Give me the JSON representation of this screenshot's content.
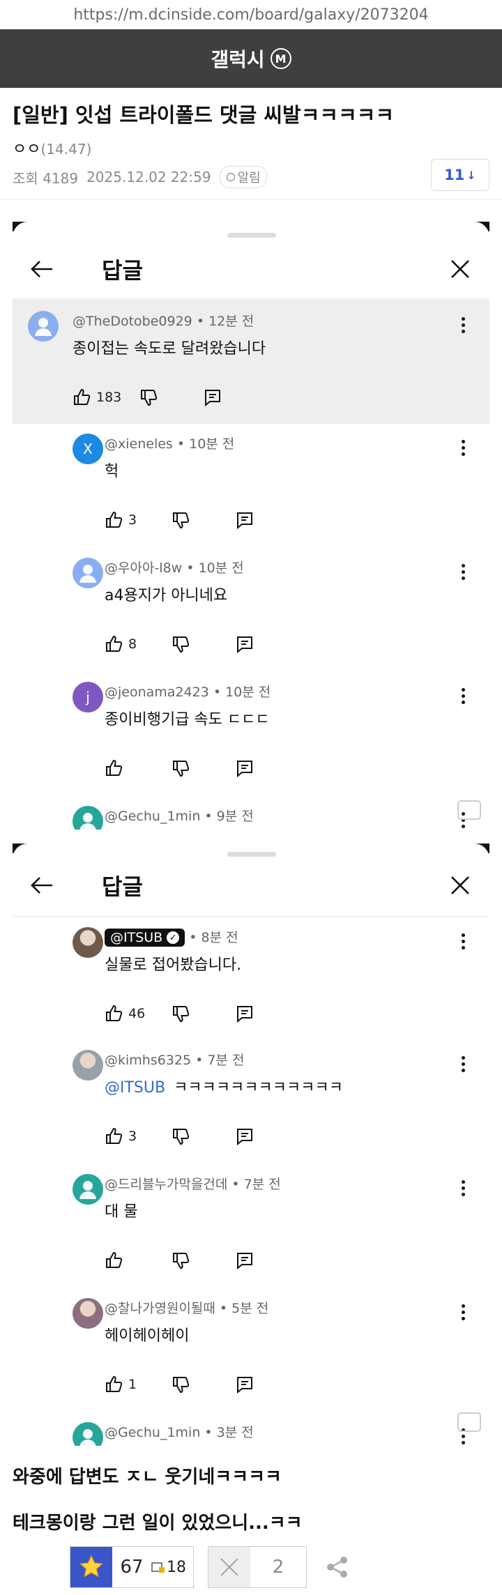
{
  "browser": {
    "url": "https://m.dcinside.com/board/galaxy/2073204"
  },
  "gallery": {
    "name": "갤럭시",
    "badge": "M"
  },
  "post": {
    "title": "[일반] 잇섭 트라이폴드 댓글 씨발ㅋㅋㅋㅋㅋ",
    "author": "ㅇㅇ",
    "author_ip": "(14.47)",
    "views": "조회 4189",
    "datetime": "2025.12.02 22:59",
    "alarm_label": "알림",
    "comment_count": "11",
    "body_lines": [
      "와중에 답변도 ㅈㄴ 웃기네ㅋㅋㅋㅋ",
      "테크몽이랑 그런 일이 있었으니...ㅋㅋ"
    ]
  },
  "screenshot1": {
    "title": "답글",
    "comments": [
      {
        "user": "@TheDotobe0929",
        "time": "12분 전",
        "text": "종이접는 속도로 달려왔습니다",
        "likes": "183",
        "avatar_letter": "",
        "avatar_color": "#8aaef0"
      },
      {
        "user": "@xieneles",
        "time": "10분 전",
        "text": "헉",
        "likes": "3",
        "avatar_letter": "X",
        "avatar_color": "#1e88e5"
      },
      {
        "user": "@우아아-l8w",
        "time": "10분 전",
        "text": "a4용지가 아니네요",
        "likes": "8",
        "avatar_letter": "",
        "avatar_color": "#8aaef0"
      },
      {
        "user": "@jeonama2423",
        "time": "10분 전",
        "text": "종이비행기급 속도 ㄷㄷㄷ",
        "likes": "",
        "avatar_letter": "j",
        "avatar_color": "#7e57c2"
      },
      {
        "user": "@Gechu_1min",
        "time": "9분 전",
        "text": "",
        "likes": "",
        "avatar_letter": "",
        "avatar_color": "#26a69a"
      }
    ]
  },
  "screenshot2": {
    "title": "답글",
    "comments": [
      {
        "user": "@ITSUB",
        "time": "8분 전",
        "text": "실물로 접어봤습니다.",
        "likes": "46",
        "avatar_color": "#6d5a4a"
      },
      {
        "user": "@kimhs6325",
        "time": "7분 전",
        "mention": "@ITSUB",
        "text": "ㅋㅋㅋㅋㅋㅋㅋㅋㅋㅋㅋㅋ",
        "likes": "3",
        "avatar_color": "#9aa0a6"
      },
      {
        "user": "@드리블누가막을건데",
        "time": "7분 전",
        "text": "대 물",
        "likes": "",
        "avatar_color": "#26a69a"
      },
      {
        "user": "@찰나가영원이될때",
        "time": "5분 전",
        "text": "헤이헤이헤이",
        "likes": "1",
        "avatar_color": "#8d6e80"
      },
      {
        "user": "@Gechu_1min",
        "time": "3분 전",
        "text": "",
        "likes": "",
        "avatar_color": "#26a69a"
      }
    ]
  },
  "votes": {
    "recommend": "67",
    "fixed_recommend": "18",
    "non_recommend": "2"
  },
  "colors": {
    "accent": "#3b55c8",
    "header_bg": "#3f3f3f",
    "link": "#2f6bd3"
  }
}
